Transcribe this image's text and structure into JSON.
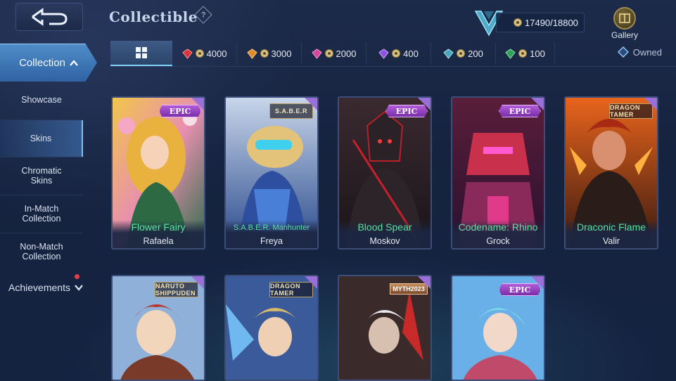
{
  "header": {
    "title": "Collectible",
    "help_symbol": "?",
    "points": "17490/18800",
    "gallery_label": "Gallery"
  },
  "filters": {
    "all_icon": "grid-icon",
    "tiers": [
      {
        "cost": "4000",
        "color": "#d8343c"
      },
      {
        "cost": "3000",
        "color": "#e08a2c"
      },
      {
        "cost": "2000",
        "color": "#d4489a"
      },
      {
        "cost": "400",
        "color": "#8f52e0"
      },
      {
        "cost": "200",
        "color": "#4aa6b8"
      },
      {
        "cost": "100",
        "color": "#2fa05a"
      }
    ],
    "owned_label": "Owned"
  },
  "sidebar": {
    "collection_label": "Collection",
    "items": [
      {
        "label": "Showcase"
      },
      {
        "label": "Skins"
      },
      {
        "label": "Chromatic Skins"
      },
      {
        "label": "In-Match Collection"
      },
      {
        "label": "Non-Match Collection"
      }
    ],
    "achievements_label": "Achievements"
  },
  "cards": [
    {
      "skin": "Flower Fairy",
      "hero": "Rafaela",
      "badge": "EPIC"
    },
    {
      "skin": "S.A.B.E.R. Manhunter",
      "hero": "Freya",
      "badge": "S.A.B.E.R"
    },
    {
      "skin": "Blood Spear",
      "hero": "Moskov",
      "badge": "EPIC"
    },
    {
      "skin": "Codename: Rhino",
      "hero": "Grock",
      "badge": "EPIC"
    },
    {
      "skin": "Draconic Flame",
      "hero": "Valir",
      "badge": "DRAGON TAMER"
    },
    {
      "skin": "",
      "hero": "",
      "badge": "NARUTO SHIPPUDEN"
    },
    {
      "skin": "",
      "hero": "",
      "badge": "DRAGON TAMER"
    },
    {
      "skin": "",
      "hero": "",
      "badge": "MYTH2023"
    },
    {
      "skin": "",
      "hero": "",
      "badge": "EPIC"
    }
  ],
  "colors": {
    "accent": "#7fd2ff",
    "skin_name": "#58e1a1",
    "epic_badge": "#9a44c8"
  }
}
